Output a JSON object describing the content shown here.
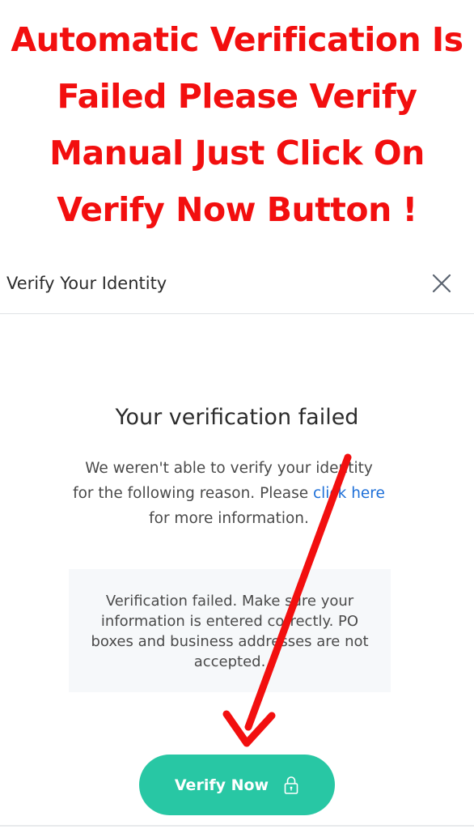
{
  "headline": {
    "lines": [
      "Automatic Verification Is",
      "Failed Please Verify",
      "Manual Just Click On",
      "Verify Now Button !"
    ],
    "color": "#f20f0f"
  },
  "modal": {
    "title": "Verify Your Identity",
    "close_icon": "close-icon",
    "heading": "Your verification failed",
    "reason_prefix": "We weren't able to verify your identity for the following reason. Please ",
    "reason_link": "click here",
    "reason_suffix": " for more information.",
    "info_message": "Verification failed. Make sure your information is entered correctly. PO boxes and business addresses are not accepted.",
    "verify_button_label": "Verify Now",
    "verify_button_icon": "lock-icon",
    "accent_color": "#28c7a4",
    "link_color": "#1d6fd8"
  },
  "annotation": {
    "arrow_icon": "red-arrow-icon",
    "color": "#f20f0f"
  }
}
